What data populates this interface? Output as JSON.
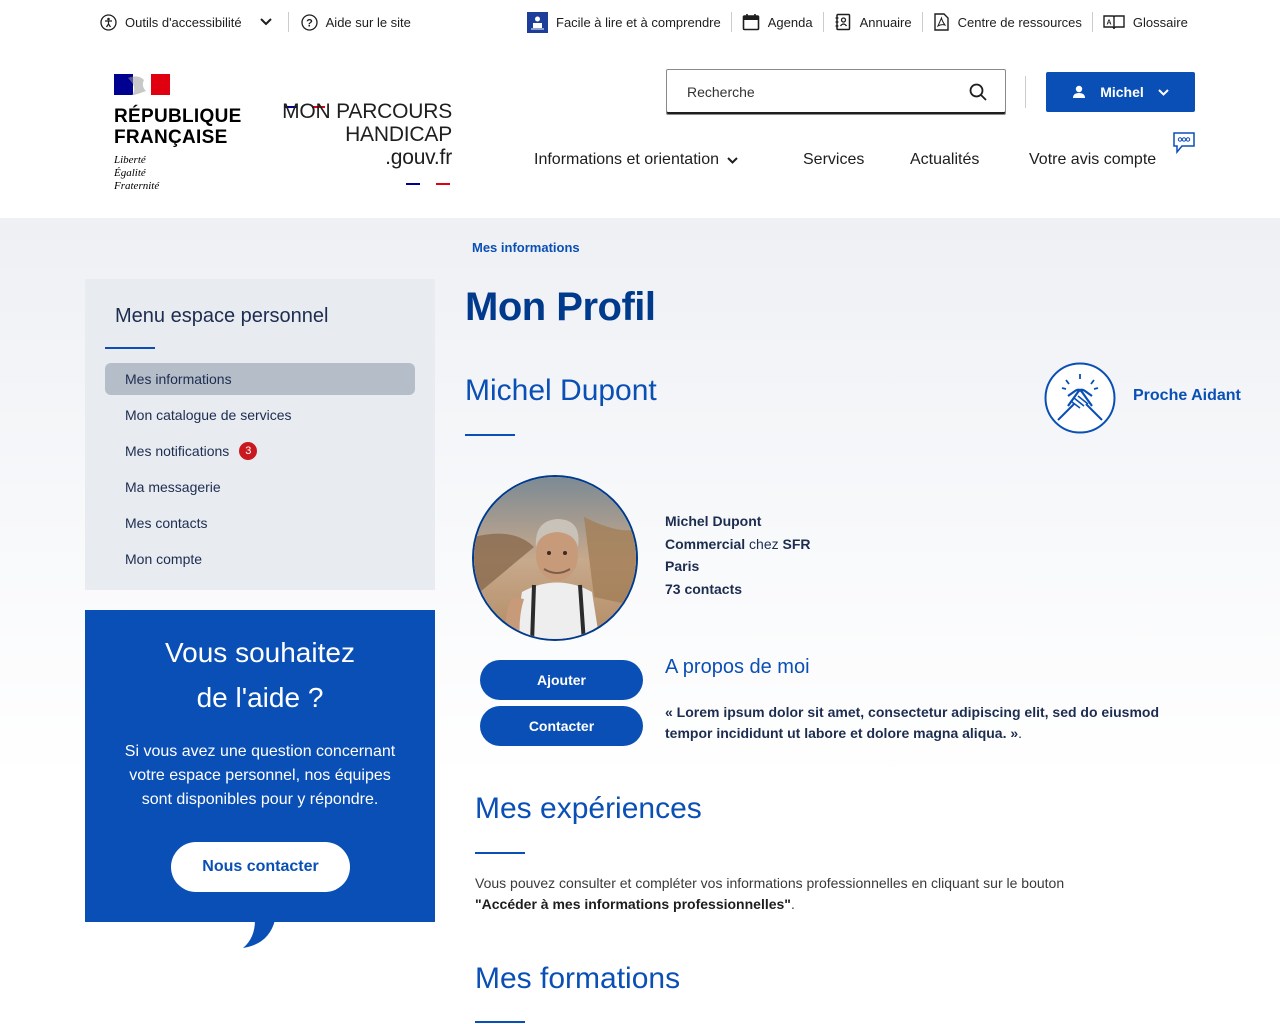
{
  "topbar": {
    "accessibility_label": "Outils d'accessibilité",
    "help_label": "Aide sur le site",
    "easy_read_label": "Facile à lire et à comprendre",
    "agenda_label": "Agenda",
    "directory_label": "Annuaire",
    "resources_label": "Centre de ressources",
    "glossary_label": "Glossaire"
  },
  "brand": {
    "republique_line1": "RÉPUBLIQUE",
    "republique_line2": "FRANÇAISE",
    "motto1": "Liberté",
    "motto2": "Égalité",
    "motto3": "Fraternité",
    "site_line1": "MON PARCOURS",
    "site_line2": "HANDICAP",
    "site_line3": ".gouv.fr"
  },
  "search": {
    "placeholder": "Recherche"
  },
  "user": {
    "name": "Michel"
  },
  "nav": {
    "items": [
      {
        "label": "Informations et orientation"
      },
      {
        "label": "Services"
      },
      {
        "label": "Actualités"
      },
      {
        "label": "Votre avis compte"
      }
    ]
  },
  "breadcrumb": {
    "current": "Mes informations"
  },
  "sidebar": {
    "title": "Menu espace personnel",
    "items": [
      {
        "label": "Mes informations"
      },
      {
        "label": "Mon catalogue de services"
      },
      {
        "label": "Mes notifications",
        "badge": "3"
      },
      {
        "label": "Ma messagerie"
      },
      {
        "label": "Mes contacts"
      },
      {
        "label": "Mon compte"
      }
    ]
  },
  "help_box": {
    "title_line1": "Vous souhaitez",
    "title_line2": "de l'aide ?",
    "text": "Si vous avez une question concernant votre espace personnel, nos équipes sont disponibles pour y répondre.",
    "button": "Nous contacter"
  },
  "profile": {
    "page_title": "Mon Profil",
    "full_name": "Michel Dupont",
    "role_badge": "Proche Aidant",
    "card_name": "Michel Dupont",
    "job_title": "Commercial",
    "job_at": "chez",
    "company": "SFR",
    "city": "Paris",
    "contacts": "73 contacts",
    "add_button": "Ajouter",
    "contact_button": "Contacter",
    "about_title": "A propos de moi",
    "about_text": "« Lorem ipsum dolor sit amet, consectetur adipiscing elit, sed do eiusmod tempor incididunt ut labore et dolore magna aliqua. »",
    "about_end": "."
  },
  "experiences": {
    "title": "Mes expériences",
    "text": "Vous pouvez consulter et compléter vos informations professionnelles en cliquant sur le bouton",
    "link_text": "\"Accéder à mes informations professionnelles\"",
    "text_end": "."
  },
  "formations": {
    "title": "Mes formations"
  },
  "colors": {
    "primary": "#0a4fb5",
    "dark_blue": "#003a8c",
    "marianne_red": "#e1000f",
    "badge_red": "#c9191e"
  }
}
